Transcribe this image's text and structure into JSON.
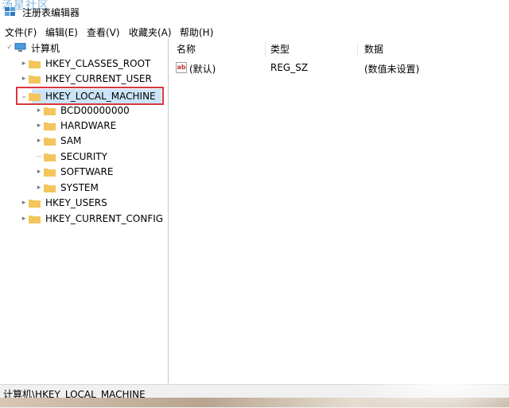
{
  "window": {
    "watermark": "汤星社区",
    "title": "注册表编辑器"
  },
  "menu": [
    {
      "label": "文件(F)"
    },
    {
      "label": "编辑(E)"
    },
    {
      "label": "查看(V)"
    },
    {
      "label": "收藏夹(A)"
    },
    {
      "label": "帮助(H)"
    }
  ],
  "tree": {
    "root": "计算机",
    "nodes": [
      {
        "label": "HKEY_CLASSES_ROOT",
        "expandable": true
      },
      {
        "label": "HKEY_CURRENT_USER",
        "expandable": true
      },
      {
        "label": "HKEY_LOCAL_MACHINE",
        "expanded": true,
        "selected": true
      },
      {
        "label": "BCD00000000",
        "expandable": true
      },
      {
        "label": "HARDWARE",
        "expandable": true
      },
      {
        "label": "SAM",
        "expandable": true
      },
      {
        "label": "SECURITY",
        "expandable": false
      },
      {
        "label": "SOFTWARE",
        "expandable": true
      },
      {
        "label": "SYSTEM",
        "expandable": true
      },
      {
        "label": "HKEY_USERS",
        "expandable": true
      },
      {
        "label": "HKEY_CURRENT_CONFIG",
        "expandable": true
      }
    ]
  },
  "list": {
    "columns": [
      "名称",
      "类型",
      "数据"
    ],
    "rows": [
      {
        "icon": "string-value-icon",
        "icon_text": "ab",
        "name": "(默认)",
        "type": "REG_SZ",
        "data": "(数值未设置)"
      }
    ]
  },
  "status": {
    "path": "计算机\\HKEY_LOCAL_MACHINE"
  },
  "colors": {
    "selection_outline": "#d9363e",
    "selection_fill": "#cce4f7",
    "folder": "#f3c55a"
  }
}
